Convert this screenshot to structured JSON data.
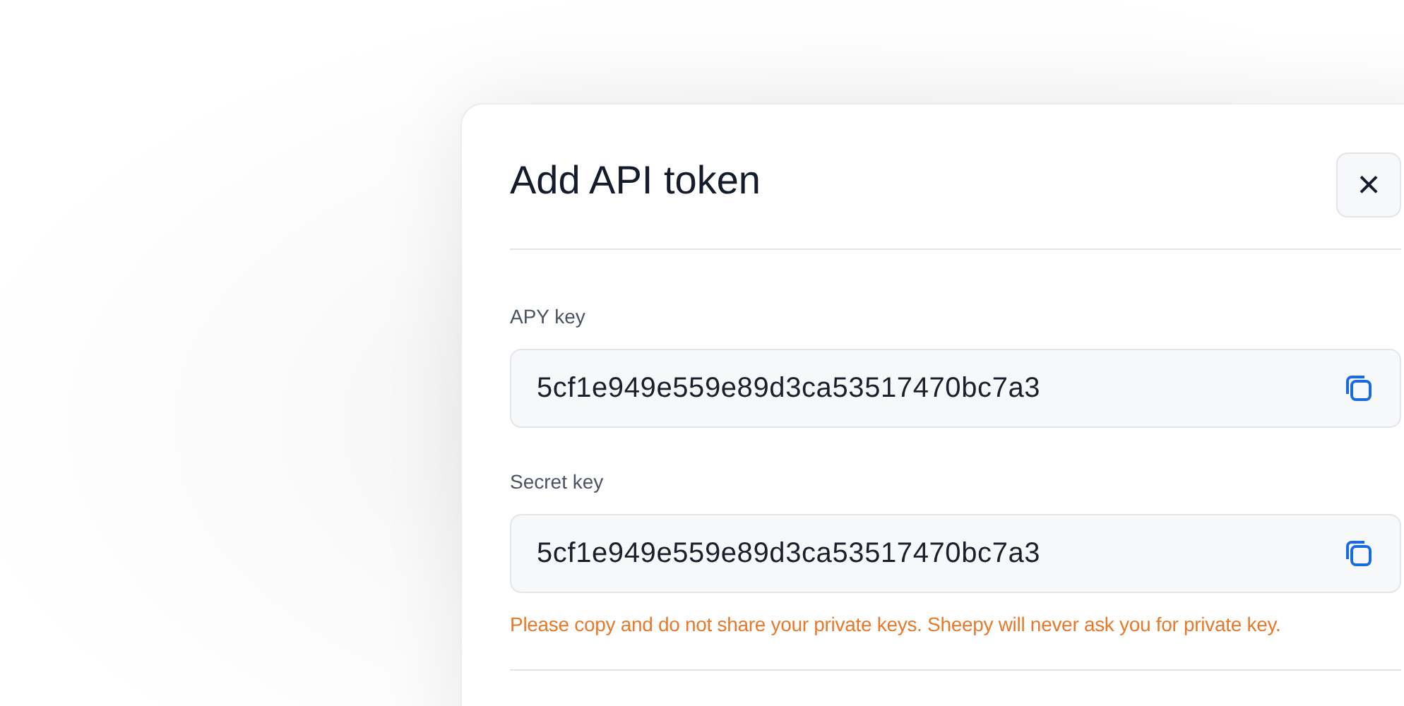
{
  "dialog": {
    "title": "Add API token",
    "close_label": "×",
    "fields": [
      {
        "label": "APY key",
        "value": "5cf1e949e559e89d3ca53517470bc7a3"
      },
      {
        "label": "Secret key",
        "value": "5cf1e949e559e89d3ca53517470bc7a3"
      }
    ],
    "warning": "Please copy and do not share your private keys. Sheepy will never ask you for private key."
  }
}
